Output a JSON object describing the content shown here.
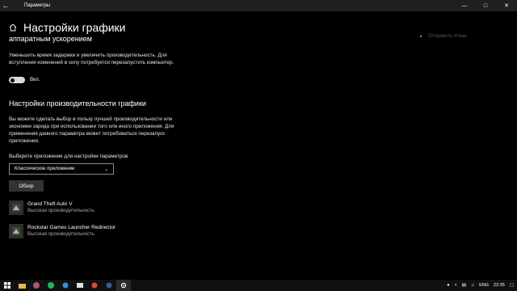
{
  "window": {
    "title": "Параметры"
  },
  "page": {
    "title": "Настройки графики",
    "sub_heading": "аппаратным ускорением",
    "description1": "Уменьшить время задержки и увеличить производительность. Для вступления изменений в силу потребуется перезапустить компьютер.",
    "toggle_state": "Вкл.",
    "section_heading": "Настройки производительности графики",
    "description2": "Вы можете сделать выбор в пользу лучшей производительности или экономии заряда при использовании того или иного приложения. Для применения данного параметра может потребоваться перезапуск приложения.",
    "choose_label": "Выберите приложение для настройки параметров",
    "dropdown_value": "Классическое приложение",
    "browse_button": "Обзор",
    "feedback_link": "Отправить отзыв"
  },
  "apps": [
    {
      "name": "Grand Theft Auto V",
      "preference": "Высокая производительность",
      "icon": "gta-icon"
    },
    {
      "name": "Rockstar Games Launcher Redirector",
      "preference": "Высокая производительность",
      "icon": "rockstar-icon"
    }
  ],
  "taskbar": {
    "language": "ENG",
    "time": "22:35"
  },
  "colors": {
    "background": "#000000",
    "titlebar": "#1f1f1f",
    "toggle_on": "#d9d9d9",
    "button": "#333333"
  }
}
